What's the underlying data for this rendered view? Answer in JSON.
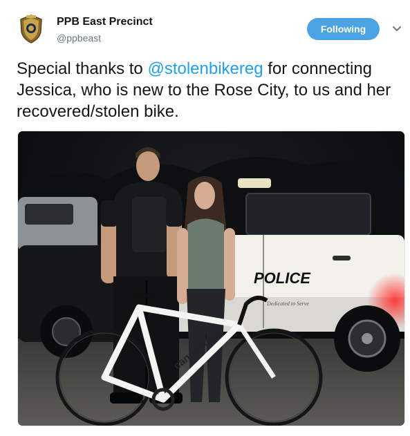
{
  "account": {
    "display_name": "PPB East Precinct",
    "handle": "@ppbeast",
    "avatar_icon": "police-badge-icon"
  },
  "actions": {
    "follow_label": "Following",
    "menu_icon": "chevron-down-icon"
  },
  "tweet": {
    "text_before": "Special thanks to ",
    "mention": "@stolenbikereg",
    "text_after": " for connecting Jessica, who is new to the Rose City, to us and her recovered/stolen bike."
  },
  "media": {
    "car_text": "POLICE",
    "car_motto": "Dedicated to Serve",
    "bike_brand": "cannondale"
  },
  "colors": {
    "accent": "#1da1f2",
    "follow_button": "#4ba3e3"
  }
}
